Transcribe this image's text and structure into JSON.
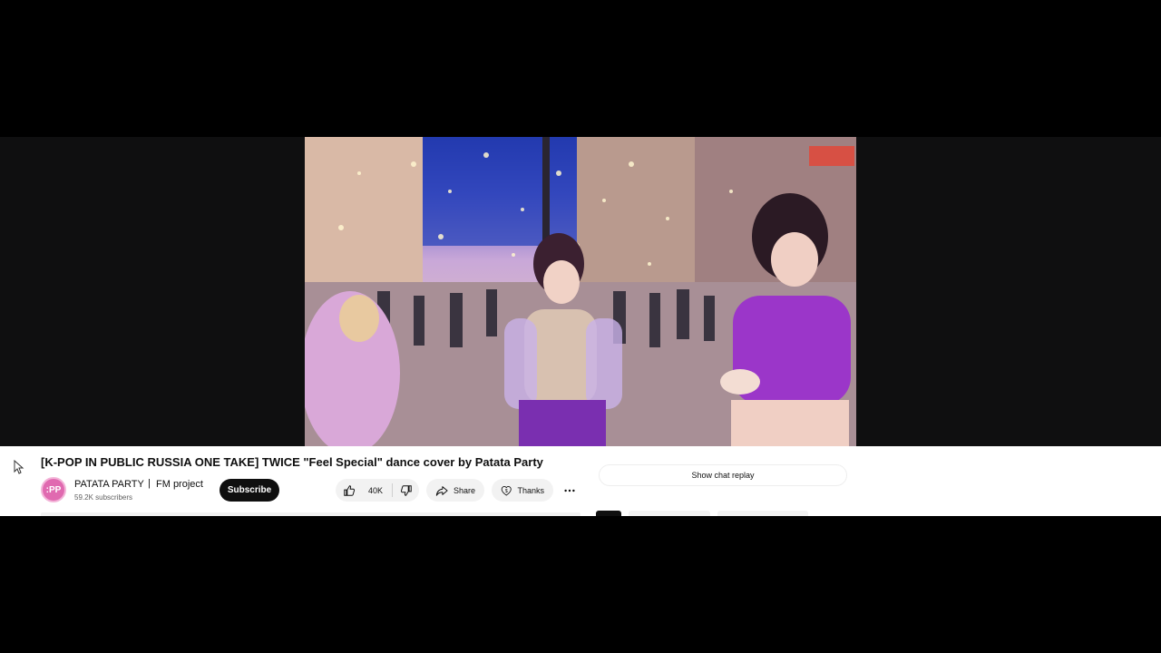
{
  "video": {
    "title": "[K-POP IN PUBLIC RUSSIA ONE TAKE] TWICE \"Feel Special\" dance cover by Patata Party",
    "description": ""
  },
  "channel": {
    "avatar_text": ":PP",
    "name": "PATATA PARTY",
    "separator": "|",
    "collab": "FM project",
    "subscribers": "59.2K subscribers"
  },
  "actions": {
    "subscribe_label": "Subscribe",
    "like_count": "40K",
    "share_label": "Share",
    "thanks_label": "Thanks"
  },
  "chat": {
    "show_replay_label": "Show chat replay"
  },
  "icons": {
    "like": "thumbs-up-icon",
    "dislike": "thumbs-down-icon",
    "share": "share-arrow-icon",
    "thanks": "heart-dollar-icon",
    "more": "more-horizontal-icon",
    "cursor": "mouse-pointer-icon"
  },
  "colors": {
    "subscribe_bg": "#0f0f0f",
    "avatar": "#e06ab0",
    "pill_bg": "#f2f2f2"
  }
}
